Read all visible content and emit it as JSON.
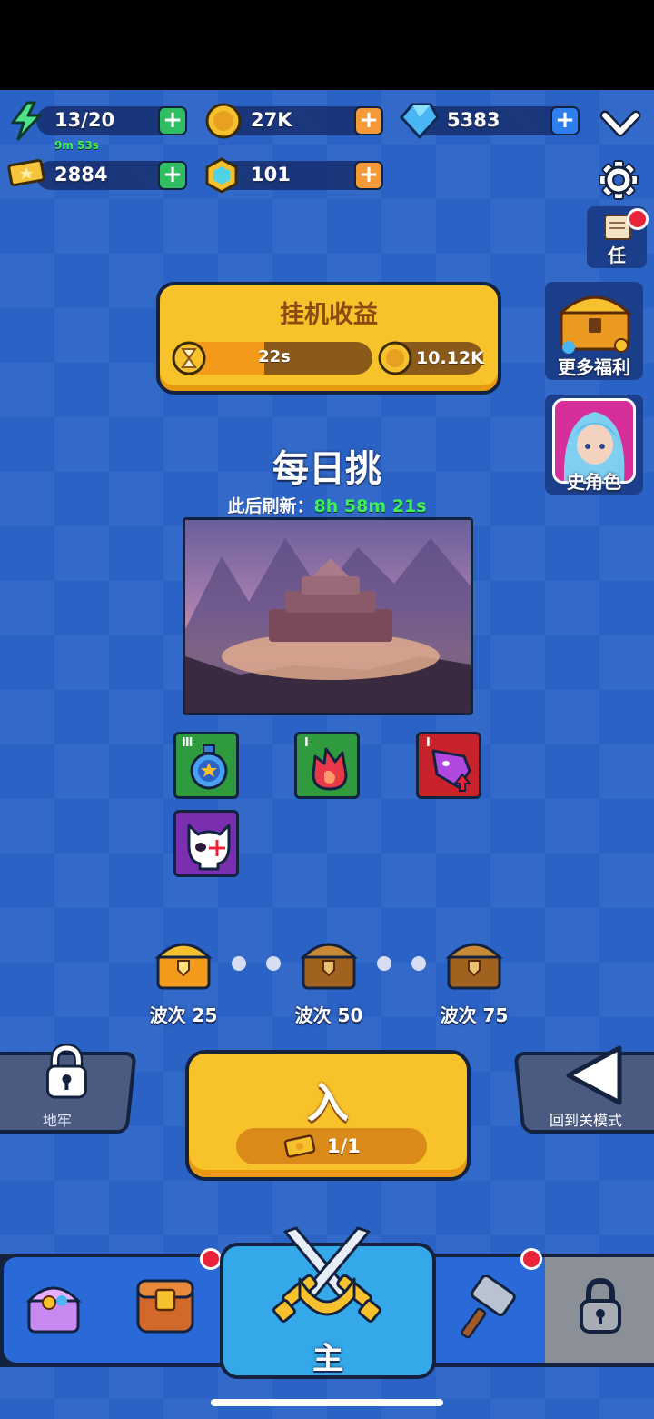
{
  "resources": {
    "energy": {
      "value": "13/20",
      "timer": "9m 53s"
    },
    "coins": {
      "value": "27K"
    },
    "gems": {
      "value": "5383"
    },
    "tickets": {
      "value": "2884"
    },
    "tokens": {
      "value": "101"
    }
  },
  "side_menu": {
    "quest_label": "任",
    "more_rewards_label": "更多福利",
    "epic_hero_label": "史角色"
  },
  "idle": {
    "title": "挂机收益",
    "timer": "22s",
    "timer_fill": 0.45,
    "reward": "10.12K"
  },
  "daily": {
    "title": "每日挑",
    "refresh_label": "此后刷新：",
    "refresh_time": "8h 58m 21s"
  },
  "modifiers": [
    {
      "icon": "stopwatch-star-icon",
      "level": "III",
      "color": "#2f9a3e"
    },
    {
      "icon": "fire-icon",
      "level": "I",
      "color": "#2f9a3e"
    },
    {
      "icon": "monster-upgrade-icon",
      "level": "I",
      "color": "#c8222c"
    },
    {
      "icon": "skull-icon",
      "level": "",
      "color": "#7a2fb0"
    }
  ],
  "milestones": [
    {
      "label": "波次 25"
    },
    {
      "label": "波次 50"
    },
    {
      "label": "波次 75"
    }
  ],
  "buttons": {
    "dungeon_label": "地牢",
    "enter_label": "入",
    "enter_count": "1/1",
    "back_label": "回到关模式"
  },
  "nav": {
    "main_label": "主"
  }
}
